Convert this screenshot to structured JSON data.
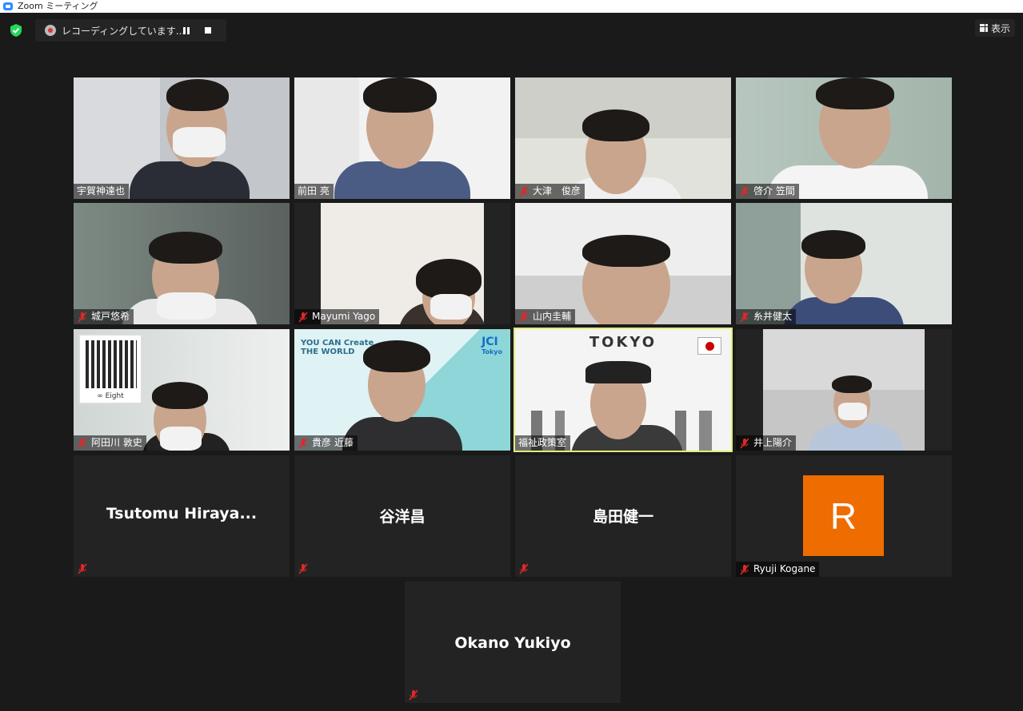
{
  "window": {
    "title": "Zoom ミーティング"
  },
  "toolbar": {
    "recording_text": "レコーディングしています...",
    "view_label": "表示"
  },
  "participants": {
    "t1": "宇賀神達也",
    "t2": "前田 亮",
    "t3": "大津　俊彦",
    "t4": "啓介 笠間",
    "t5": "城戸悠希",
    "t6": "Mayumi Yago",
    "t7": "山内圭輔",
    "t8": "糸井健太",
    "t9": "阿田川 敦史",
    "t10": "貴彦 近藤",
    "t11": "福祉政策室",
    "t12": "井上陽介",
    "t13": "Tsutomu  Hiraya...",
    "t14": "谷洋昌",
    "t15": "島田健一",
    "t16": "Ryuji Kogane",
    "t17": "Okano Yukiyo"
  },
  "avatars": {
    "ryuji_initial": "R"
  },
  "backgrounds": {
    "tokyo_caption": "TOKYO",
    "qr_caption": "∞ Eight",
    "jci_slogan_line1": "YOU CAN Create",
    "jci_slogan_line2": "THE WORLD",
    "jci_logo": "JCI",
    "jci_logo_sub": "Tokyo"
  },
  "colors": {
    "active_speaker_border": "#e3ec7a",
    "mute_red": "#e02828",
    "shield_green": "#23d959",
    "avatar_orange": "#ef6c00"
  }
}
